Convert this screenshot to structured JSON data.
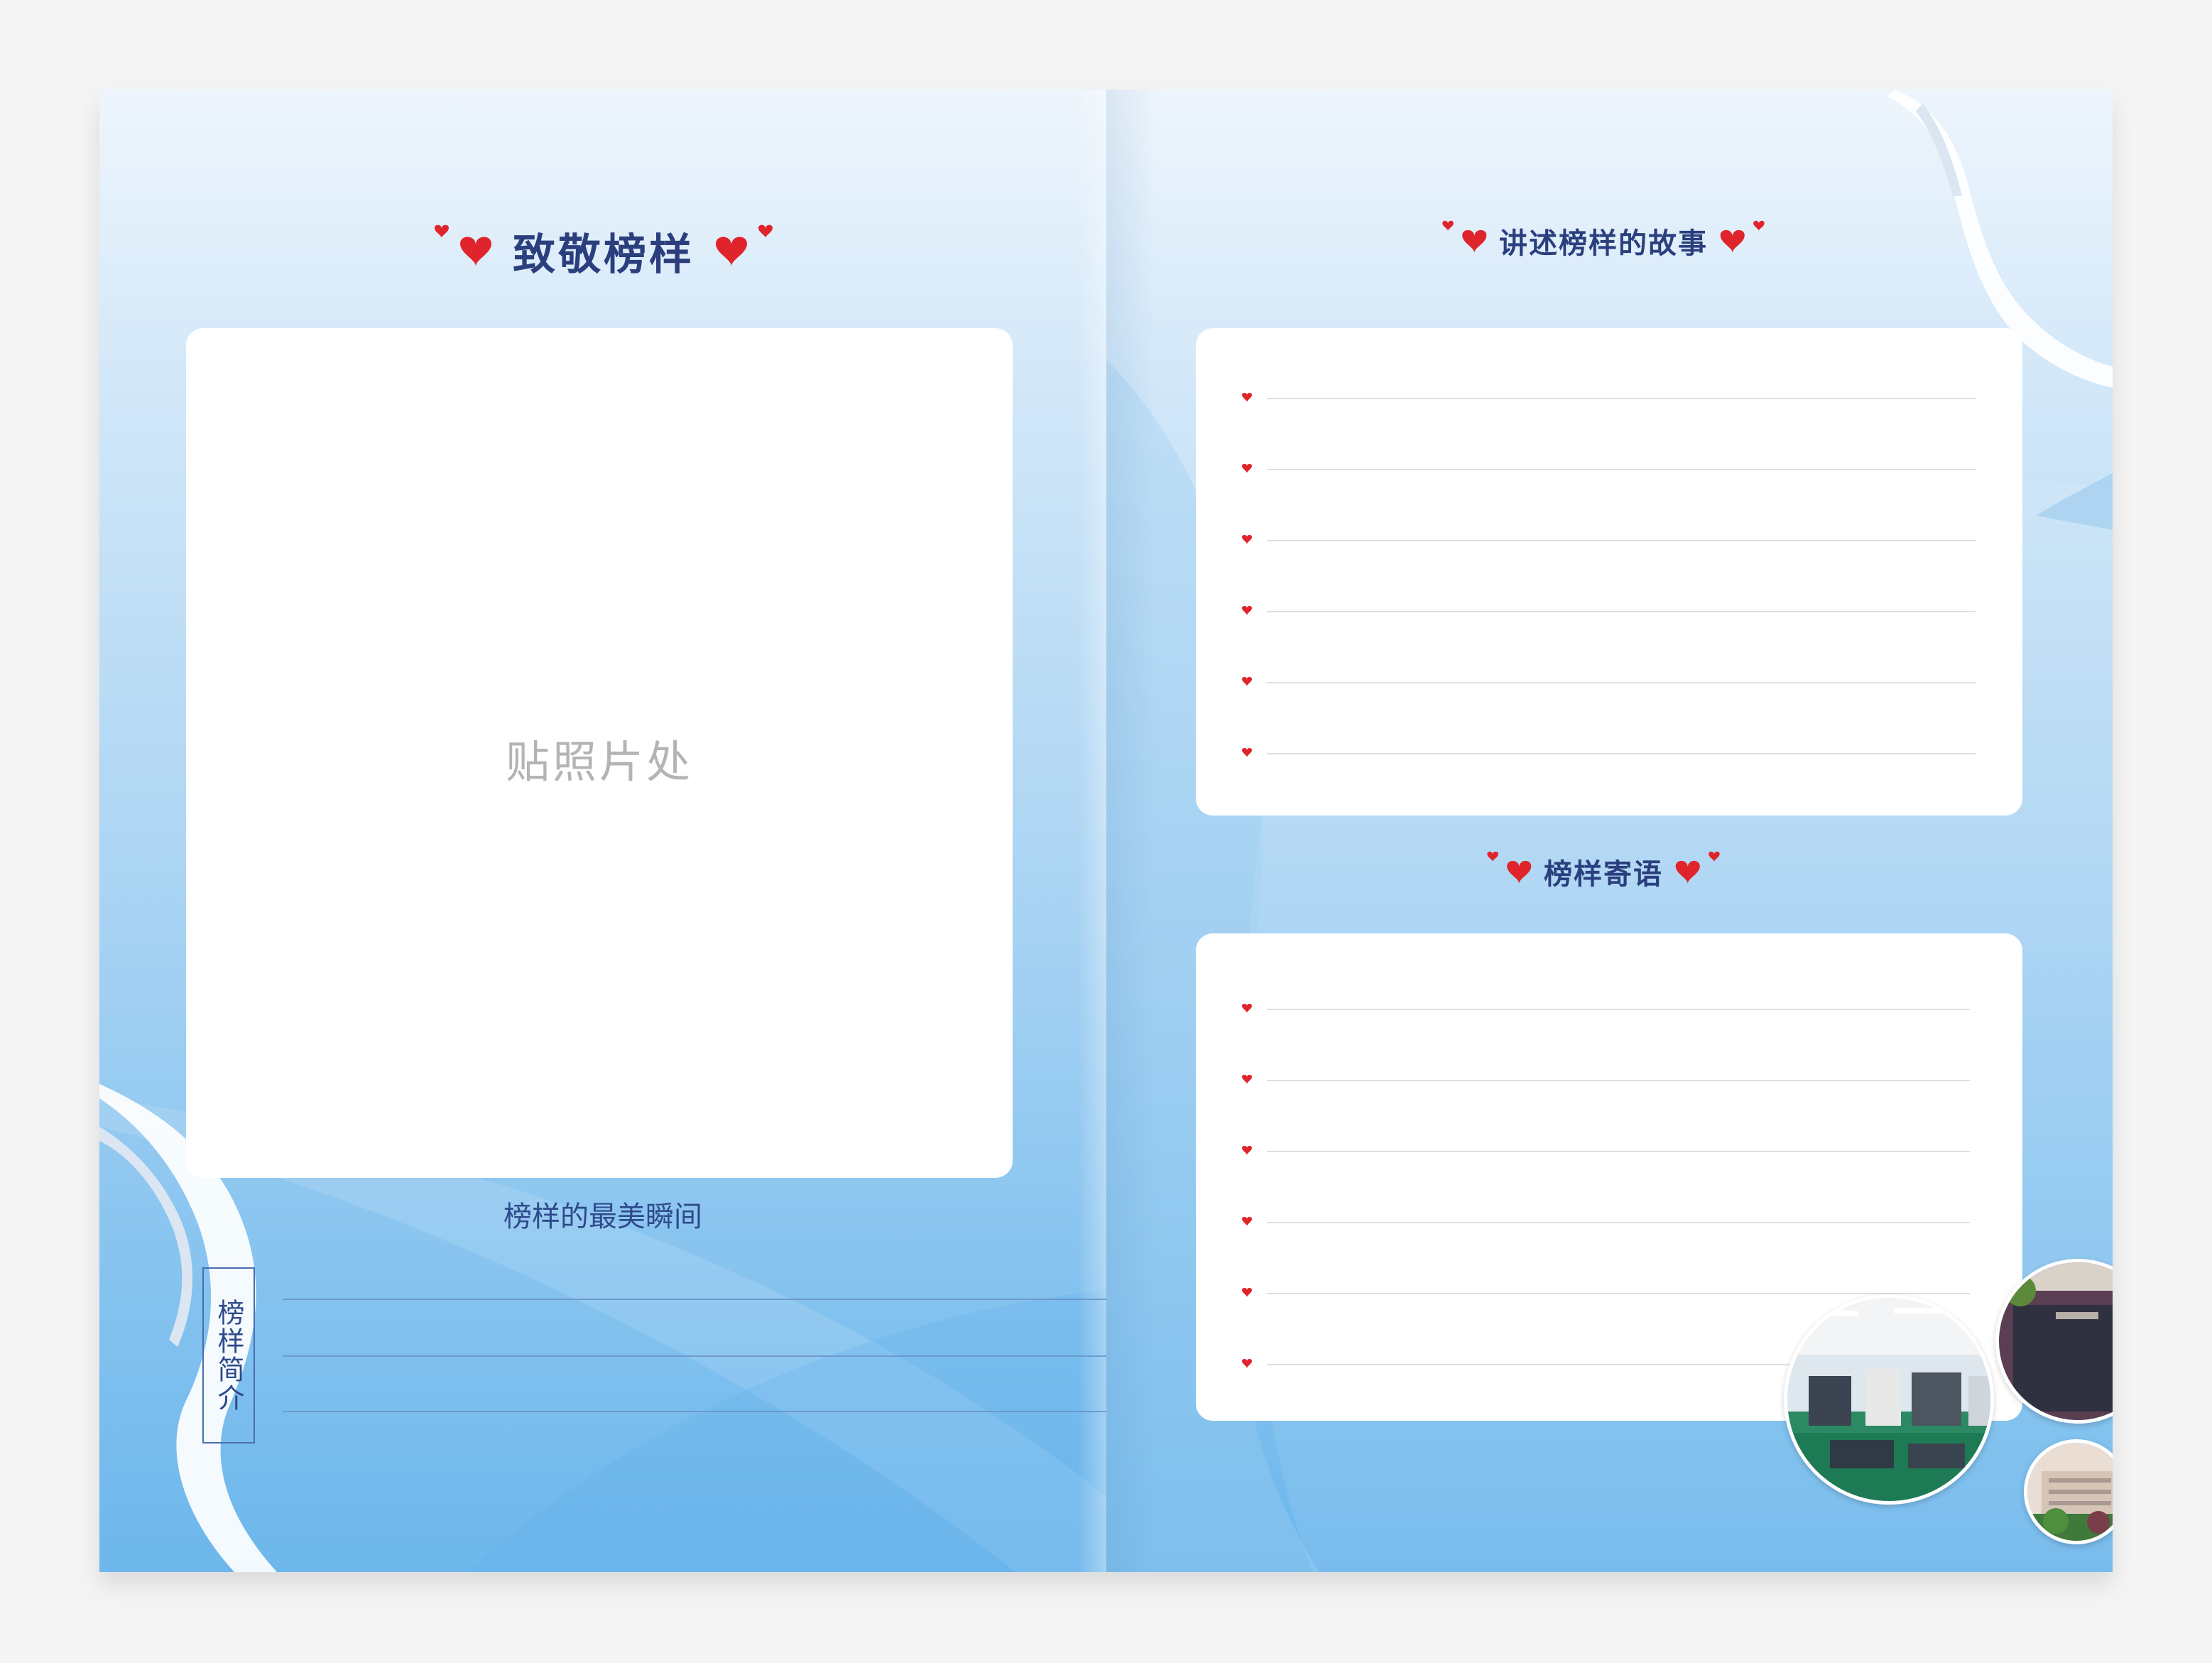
{
  "left_page": {
    "title": "致敬榜样",
    "photo_placeholder": "贴照片处",
    "photo_caption": "榜样的最美瞬间",
    "bio_label": "榜样简介"
  },
  "right_page": {
    "story_title": "讲述榜样的故事",
    "message_title": "榜样寄语"
  },
  "colors": {
    "title": "#2b3f7e",
    "heart": "#e0242b",
    "page_top": "#eef5fc",
    "page_bottom": "#6db7ec"
  },
  "icons": {
    "heart": "heart-icon",
    "ribbon": "ribbon-decoration"
  }
}
